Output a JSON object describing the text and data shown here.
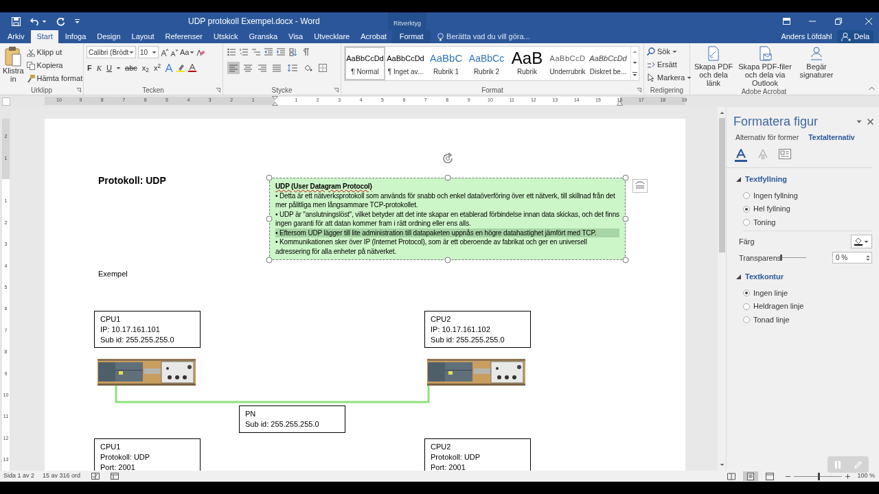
{
  "title_bar": {
    "title": "UDP protokoll Exempel.docx - Word",
    "context_group": "Ritverktyg"
  },
  "tabs": [
    {
      "label": "Arkiv",
      "selected": false,
      "kind": "tab"
    },
    {
      "label": "Start",
      "selected": true,
      "kind": "tab"
    },
    {
      "label": "Infoga",
      "selected": false,
      "kind": "tab"
    },
    {
      "label": "Design",
      "selected": false,
      "kind": "tab"
    },
    {
      "label": "Layout",
      "selected": false,
      "kind": "tab"
    },
    {
      "label": "Referenser",
      "selected": false,
      "kind": "tab"
    },
    {
      "label": "Utskick",
      "selected": false,
      "kind": "tab"
    },
    {
      "label": "Granska",
      "selected": false,
      "kind": "tab"
    },
    {
      "label": "Visa",
      "selected": false,
      "kind": "tab"
    },
    {
      "label": "Utvecklare",
      "selected": false,
      "kind": "tab"
    },
    {
      "label": "Acrobat",
      "selected": false,
      "kind": "tab"
    },
    {
      "label": "Format",
      "selected": false,
      "kind": "context"
    }
  ],
  "tell_me": {
    "placeholder": "Berätta vad du vill göra..."
  },
  "account": {
    "user": "Anders Löfdahl",
    "share": "Dela"
  },
  "ribbon": {
    "clipboard": {
      "label": "Urklipp",
      "paste": "Klistra in",
      "items": [
        "Klipp ut",
        "Kopiera",
        "Hämta format"
      ]
    },
    "font": {
      "label": "Tecken",
      "family": "Calibri (Brödt",
      "size": "10",
      "case": "Aa",
      "formats": [
        "F",
        "K",
        "U",
        "abc",
        "x$_{2}$",
        "x$^{2}$"
      ]
    },
    "paragraph": {
      "label": "Stycke",
      "align": [
        {
          "selected": true
        },
        {
          "selected": false
        },
        {
          "selected": false
        },
        {
          "selected": false
        }
      ]
    },
    "styles": {
      "label": "Format",
      "items": [
        {
          "sample": "AaBbCcDd",
          "name": "¶ Normal",
          "selected": true,
          "kind": "normal"
        },
        {
          "sample": "AaBbCcDd",
          "name": "¶ Inget av...",
          "selected": false,
          "kind": "nospacing"
        },
        {
          "sample": "AaBbC",
          "name": "Rubrik 1",
          "selected": false,
          "kind": "heading1"
        },
        {
          "sample": "AaBbCc",
          "name": "Rubrik 2",
          "selected": false,
          "kind": "heading2"
        },
        {
          "sample": "AaB",
          "name": "Rubrik",
          "selected": false,
          "kind": "title"
        },
        {
          "sample": "AaBbCcD",
          "name": "Underrubrik",
          "selected": false,
          "kind": "subtitle"
        },
        {
          "sample": "AaBbCcDd",
          "name": "Diskret be...",
          "selected": false,
          "kind": "subtle"
        }
      ]
    },
    "editing": {
      "label": "Redigering",
      "items": [
        "Sök",
        "Ersätt",
        "Markera"
      ]
    },
    "acrobat": {
      "label": "Adobe Acrobat",
      "items": [
        "Skapa PDF och dela länk",
        "Skapa PDF-filer och dela via Outlook",
        "Begär signaturer"
      ]
    }
  },
  "ruler": {
    "horizontal": [
      "10",
      "9",
      "8",
      "7",
      "6",
      "5",
      "4",
      "3",
      "2",
      "1",
      "1",
      "2",
      "3",
      "4",
      "5",
      "6",
      "7",
      "8",
      "9",
      "10",
      "11",
      "12",
      "13",
      "14",
      "15",
      "16",
      "17",
      "18",
      "19"
    ],
    "vertical": [
      "2",
      "1",
      "1",
      "2",
      "3",
      "4",
      "5",
      "6",
      "7",
      "8",
      "9",
      "10",
      "11",
      "12",
      "13"
    ]
  },
  "document": {
    "heading": "Protokoll: UDP",
    "text_box": {
      "title": "UDP (User Datagram Protocol)",
      "bullets": [
        {
          "text": "• Detta är ett nätverksprotokoll som används för snabb och enkel dataöverföring över ett nätverk, till skillnad från det mer pålitliga men långsammare TCP-protokollet.",
          "highlighted": false
        },
        {
          "text": "• UDP är \"anslutningslöst\", vilket betyder att det inte skapar en etablerad förbindelse innan data skickas, och det finns ingen garanti för att datan kommer fram i rätt ordning eller ens alls.",
          "highlighted": false
        },
        {
          "text": "• Eftersom UDP lägger till lite administration till datapaketen uppnås en högre datahastighet jämfört med TCP.",
          "highlighted": true
        },
        {
          "text": "• Kommunikationen sker över IP (Internet Protocol), som är ett oberoende av fabrikat och ger en universell adressering för alla enheter på nätverket.",
          "highlighted": false
        }
      ]
    },
    "caption": "Exempel",
    "boxes": [
      {
        "lines": [
          "CPU1",
          "IP: 10.17.161.101",
          "Sub id: 255.255.255.0"
        ]
      },
      {
        "lines": [
          "CPU2",
          "IP: 10.17.161.102",
          "Sub id: 255.255.255.0"
        ]
      },
      {
        "lines": [
          "PN",
          "Sub id: 255.255.255.0"
        ]
      },
      {
        "lines": [
          "CPU1",
          "Protokoll: UDP",
          "Port: 2001"
        ]
      },
      {
        "lines": [
          "CPU2",
          "Protokoll: UDP",
          "Port: 2001"
        ]
      }
    ]
  },
  "panel": {
    "title": "Formatera figur",
    "tabs": [
      {
        "label": "Alternativ för former",
        "selected": false
      },
      {
        "label": "Textalternativ",
        "selected": true
      }
    ],
    "icon_tabs": [
      {
        "selected": true
      },
      {
        "selected": false
      },
      {
        "selected": false
      }
    ],
    "sections": [
      {
        "title": "Textfyllning",
        "expanded": true,
        "options": [
          {
            "label": "Ingen fyllning",
            "selected": false
          },
          {
            "label": "Hel fyllning",
            "selected": true
          },
          {
            "label": "Toning",
            "selected": false
          }
        ],
        "color_label": "Färg",
        "transparency": {
          "label": "Transparens",
          "level": 0,
          "reading": "0 %"
        }
      },
      {
        "title": "Textkontur",
        "expanded": true,
        "options": [
          {
            "label": "Ingen linje",
            "selected": true
          },
          {
            "label": "Heldragen linje",
            "selected": false
          },
          {
            "label": "Tonad linje",
            "selected": false
          }
        ]
      }
    ]
  },
  "status_bar": {
    "page": "Sida 1 av 2",
    "words": "15 av 316 ord",
    "views": [
      {
        "selected": false
      },
      {
        "selected": true
      },
      {
        "selected": false
      }
    ],
    "zoom": {
      "level": 0.5,
      "reading": "100 %"
    }
  }
}
